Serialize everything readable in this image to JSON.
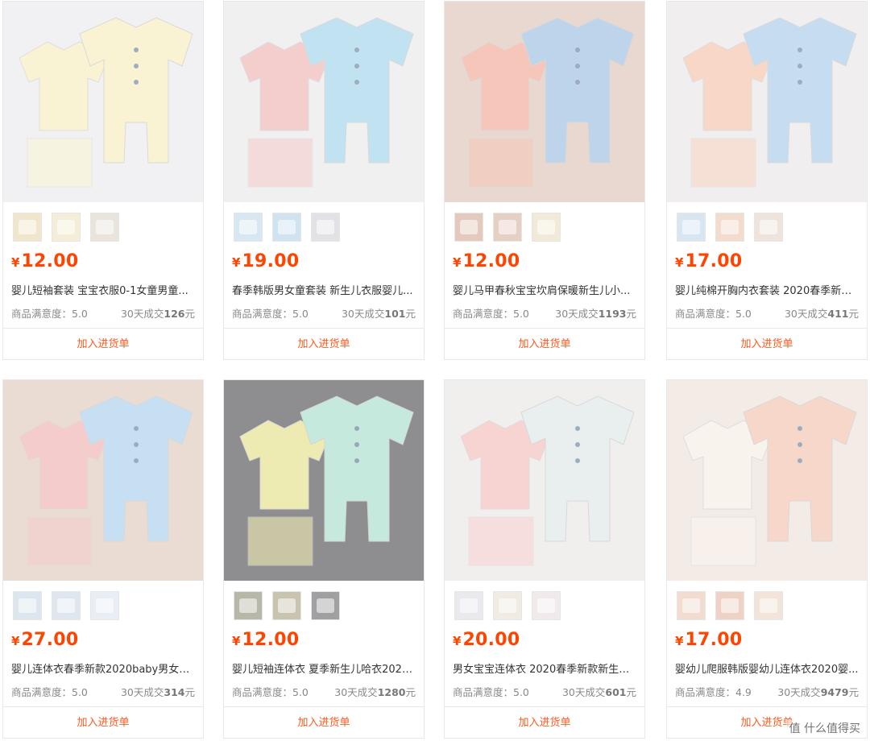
{
  "currency": "¥",
  "add_label": "加入进货单",
  "products": [
    {
      "price": "12.00",
      "title": "婴儿短袖套装 宝宝衣服0-1女童男童...",
      "satisfaction": "商品满意度：5.0",
      "sold_prefix": "30天成交",
      "sold_value": "126",
      "sold_suffix": "元",
      "image": "two cream short-sleeve sets with bear and frog faces",
      "bg": "#f1f1f3",
      "cloth_colors": [
        "#fbf4d2",
        "#fbf4d2"
      ],
      "thumbs": [
        "#efe6cc",
        "#f4eed8",
        "#e9e4dc"
      ]
    },
    {
      "price": "19.00",
      "title": "春季韩版男女童套装 新生儿衣服婴儿...",
      "satisfaction": "商品满意度：5.0",
      "sold_prefix": "30天成交",
      "sold_value": "101",
      "sold_suffix": "元",
      "image": "light blue long-sleeve set with pink and grey folded tops",
      "bg": "#f0f0f0",
      "cloth_colors": [
        "#bfe2f2",
        "#f5cccc"
      ],
      "thumbs": [
        "#d7e8f2",
        "#cfe3f0",
        "#e2e2e6"
      ]
    },
    {
      "price": "12.00",
      "title": "婴儿马甲春秋宝宝坎肩保暖新生儿小...",
      "satisfaction": "商品满意度：5.0",
      "sold_prefix": "30天成交",
      "sold_value": "1193",
      "sold_suffix": "元",
      "image": "blue baby vest with pink and cream folded vests",
      "bg": "#e8d8cf",
      "cloth_colors": [
        "#bcd4ec",
        "#f6c6b8"
      ],
      "thumbs": [
        "#e3cabd",
        "#e6cfc3",
        "#f2ead8"
      ]
    },
    {
      "price": "17.00",
      "title": "婴儿纯棉开胸内衣套装 2020春季新款...",
      "satisfaction": "商品满意度：5.0",
      "sold_prefix": "30天成交",
      "sold_value": "411",
      "sold_suffix": "元",
      "image": "blue long-sleeve set with pink and yellow folded tops",
      "bg": "#f0eeee",
      "cloth_colors": [
        "#c4dcf2",
        "#fad6c4"
      ],
      "thumbs": [
        "#d8e6f2",
        "#f3dccc",
        "#eee4dc"
      ]
    },
    {
      "price": "27.00",
      "title": "婴儿连体衣春季新款2020baby男女宝...",
      "satisfaction": "商品满意度：5.0",
      "sold_prefix": "30天成交",
      "sold_value": "314",
      "sold_suffix": "元",
      "image": "blue striped romper with pink and grey striped folded rompers",
      "bg": "#eadcd2",
      "cloth_colors": [
        "#c6e0f4",
        "#f6cccc"
      ],
      "thumbs": [
        "#dce6ee",
        "#dfe6ef",
        "#e8eef4"
      ]
    },
    {
      "price": "12.00",
      "title": "婴儿短袖连体衣 夏季新生儿哈衣2020...",
      "satisfaction": "商品满意度：5.0",
      "sold_prefix": "30天成交",
      "sold_value": "1280",
      "sold_suffix": "元",
      "image": "mint and yellow short-sleeve rompers on grey",
      "bg": "#8e8e90",
      "cloth_colors": [
        "#c8efe2",
        "#f4f0b4"
      ],
      "thumbs": [
        "#b8b8a8",
        "#c9c4b0",
        "#a0a0a2"
      ]
    },
    {
      "price": "20.00",
      "title": "男女宝宝连体衣 2020春季新款新生儿...",
      "satisfaction": "商品满意度：5.0",
      "sold_prefix": "30天成交",
      "sold_value": "601",
      "sold_suffix": "元",
      "image": "white striped romper with pink folded tops",
      "bg": "#f1eeee",
      "cloth_colors": [
        "#e9eef0",
        "#f8d2d0"
      ],
      "thumbs": [
        "#e9e9ee",
        "#f0ece4",
        "#f0eaea"
      ]
    },
    {
      "price": "17.00",
      "title": "婴幼儿爬服韩版婴幼儿连体衣2020婴...",
      "satisfaction": "商品满意度：4.9",
      "sold_prefix": "30天成交",
      "sold_value": "9479",
      "sold_suffix": "元",
      "image": "pink and white long-sleeve rompers with number 3",
      "bg": "#f3ebe6",
      "cloth_colors": [
        "#f7d6c8",
        "#faf4ee"
      ],
      "thumbs": [
        "#f2dccf",
        "#efd2c6",
        "#f2e4d8"
      ]
    }
  ],
  "watermark": "值 什么值得买"
}
